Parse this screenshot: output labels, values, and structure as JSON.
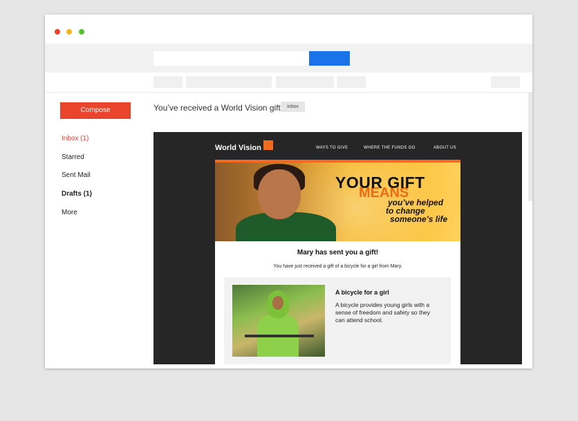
{
  "window": {
    "traffic_lights": [
      "#e8452c",
      "#f5b51f",
      "#59c12d"
    ]
  },
  "sidebar": {
    "compose_label": "Compose",
    "items": [
      {
        "label": "Inbox (1)",
        "active": true
      },
      {
        "label": "Starred"
      },
      {
        "label": "Sent Mail"
      },
      {
        "label": "Drafts (1)",
        "bold": true
      },
      {
        "label": "More"
      }
    ]
  },
  "message": {
    "subject": "You’ve received a World Vision gift",
    "label": "inbox"
  },
  "email": {
    "logo": "World Vision",
    "nav": [
      "WAYS TO GIVE",
      "WHERE THE FUNDS GO",
      "ABOUT US"
    ],
    "hero": {
      "title_line1": "YOUR GIFT",
      "title_line2": "MEANS",
      "sub_line1": "you’ve helped",
      "sub_line2": "to change",
      "sub_line3": "someone’s life"
    },
    "heading": "Mary has sent you a gift!",
    "intro": "You have just received a gift of a bicycle for a girl from Mary.",
    "card": {
      "title": "A bicycle for a girl",
      "description": "A bicycle provides young girls with a sense of freedom and safety so they can attend school."
    }
  },
  "colors": {
    "accent": "#e8452c",
    "search_button": "#1a73e8",
    "brand_orange": "#f26b1d",
    "email_frame": "#262626"
  }
}
